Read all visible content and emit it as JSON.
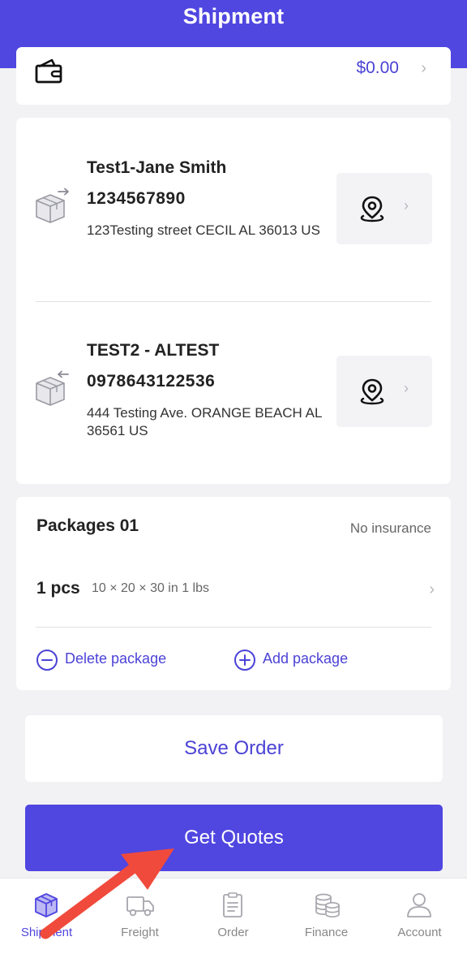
{
  "header": {
    "title": "Shipment"
  },
  "wallet": {
    "balance": "$0.00",
    "icon": "wallet-icon"
  },
  "sender": {
    "name": "Test1-Jane Smith",
    "phone": "1234567890",
    "address": "123Testing street CECIL AL 36013 US"
  },
  "receiver": {
    "name": "TEST2 - ALTEST",
    "phone": "0978643122536",
    "address": "444 Testing Ave. ORANGE BEACH AL 36561 US"
  },
  "packages": {
    "title": "Packages 01",
    "insurance": "No insurance",
    "quantity": "1 pcs",
    "dimensions": "10 × 20 × 30 in 1 lbs",
    "delete_label": "Delete package",
    "add_label": "Add package"
  },
  "actions": {
    "save_label": "Save Order",
    "quote_label": "Get Quotes"
  },
  "tabbar": {
    "items": [
      {
        "label": "Shipment",
        "icon": "package-icon",
        "active": true
      },
      {
        "label": "Freight",
        "icon": "truck-icon",
        "active": false
      },
      {
        "label": "Order",
        "icon": "clipboard-icon",
        "active": false
      },
      {
        "label": "Finance",
        "icon": "coins-icon",
        "active": false
      },
      {
        "label": "Account",
        "icon": "user-icon",
        "active": false
      }
    ]
  },
  "colors": {
    "brand": "#5046e0",
    "accent_text": "#4b42d6",
    "annotation_arrow": "#f04a3c"
  }
}
